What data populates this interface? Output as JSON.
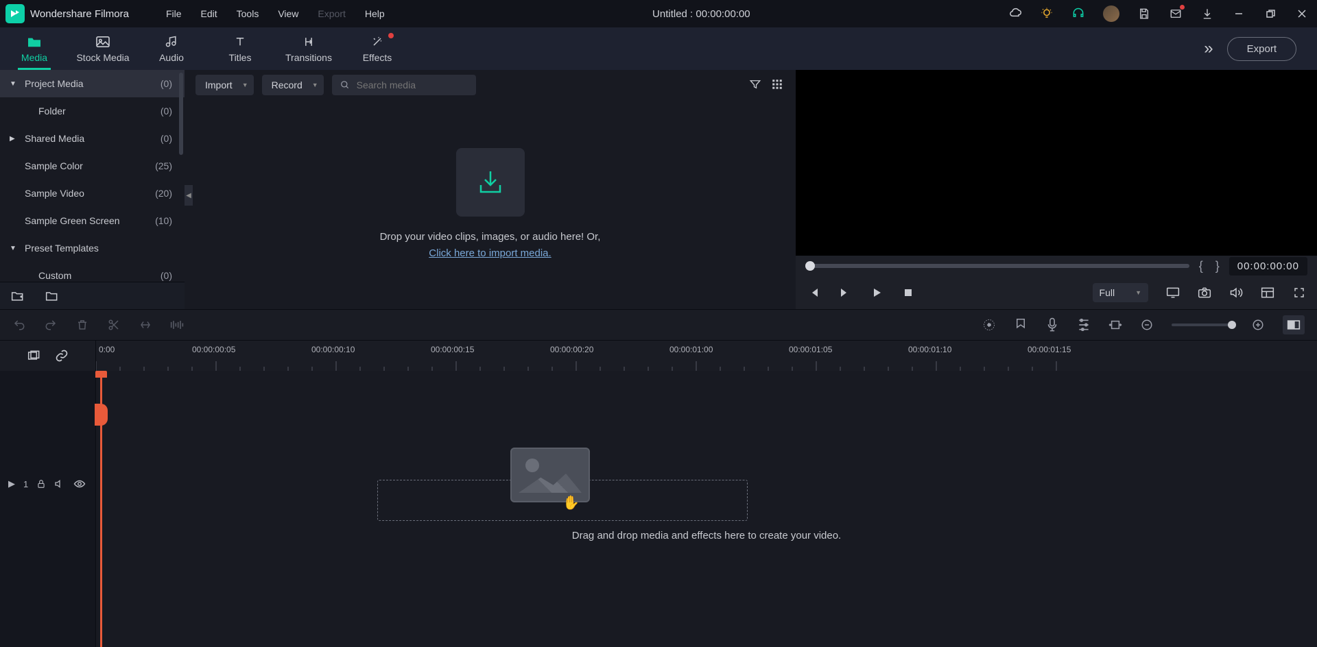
{
  "app": {
    "name": "Wondershare Filmora"
  },
  "menu": {
    "file": "File",
    "edit": "Edit",
    "tools": "Tools",
    "view": "View",
    "export": "Export",
    "help": "Help"
  },
  "title": "Untitled  :  00:00:00:00",
  "tabs": {
    "media": "Media",
    "stock": "Stock Media",
    "audio": "Audio",
    "titles": "Titles",
    "transitions": "Transitions",
    "effects": "Effects"
  },
  "export_btn": "Export",
  "sidebar": {
    "items": [
      {
        "label": "Project Media",
        "count": "(0)"
      },
      {
        "label": "Folder",
        "count": "(0)"
      },
      {
        "label": "Shared Media",
        "count": "(0)"
      },
      {
        "label": "Sample Color",
        "count": "(25)"
      },
      {
        "label": "Sample Video",
        "count": "(20)"
      },
      {
        "label": "Sample Green Screen",
        "count": "(10)"
      },
      {
        "label": "Preset Templates",
        "count": ""
      },
      {
        "label": "Custom",
        "count": "(0)"
      }
    ]
  },
  "media": {
    "import": "Import",
    "record": "Record",
    "search_ph": "Search media",
    "drop1": "Drop your video clips, images, or audio here! Or,",
    "drop2": "Click here to import media."
  },
  "preview": {
    "timecode": "00:00:00:00",
    "quality": "Full"
  },
  "ruler": [
    "0:00",
    "00:00:00:05",
    "00:00:00:10",
    "00:00:00:15",
    "00:00:00:20",
    "00:00:01:00",
    "00:00:01:05",
    "00:00:01:10",
    "00:00:01:15"
  ],
  "timeline": {
    "track_label": "1",
    "hint": "Drag and drop media and effects here to create your video."
  }
}
